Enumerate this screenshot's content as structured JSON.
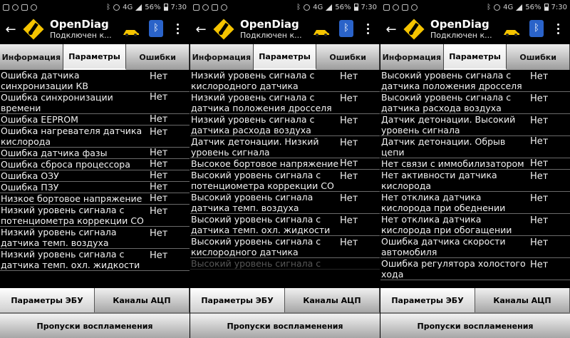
{
  "status_bar": {
    "time": "7:30",
    "battery": "56%",
    "network": "4G"
  },
  "app": {
    "title": "OpenDiag",
    "subtitle": "Подключен к..."
  },
  "tabs": [
    "Информация",
    "Параметры",
    "Ошибки"
  ],
  "active_tab": "Параметры",
  "bottom": {
    "ecu_params": "Параметры ЭБУ",
    "adc_channels": "Каналы АЦП",
    "misfires": "Пропуски воспламенения"
  },
  "screens": [
    {
      "rows": [
        {
          "name": "Ошибка датчика синхронизации КВ",
          "value": "Нет"
        },
        {
          "name": "Ошибка синхронизации времени",
          "value": "Нет"
        },
        {
          "name": "Ошибка EEPROM",
          "value": "Нет"
        },
        {
          "name": "Ошибка нагревателя датчика кислорода",
          "value": "Нет"
        },
        {
          "name": "Ошибка датчика фазы",
          "value": "Нет"
        },
        {
          "name": "Ошибка сброса процессора",
          "value": "Нет"
        },
        {
          "name": "Ошибка ОЗУ",
          "value": "Нет"
        },
        {
          "name": "Ошибка ПЗУ",
          "value": "Нет"
        },
        {
          "name": "Низкое бортовое напряжение",
          "value": "Нет"
        },
        {
          "name": "Низкий уровень сигнала с потенциометра коррекции CO",
          "value": "Нет"
        },
        {
          "name": "Низкий уровень сигнала датчика темп. воздуха",
          "value": "Нет"
        },
        {
          "name": "Низкий уровень сигнала с датчика темп. охл. жидкости",
          "value": "Нет"
        }
      ]
    },
    {
      "rows": [
        {
          "name": "Низкий уровень сигнала с кислородного датчика",
          "value": "Нет"
        },
        {
          "name": "Низкий уровень сигнала с датчика положения дросселя",
          "value": "Нет"
        },
        {
          "name": "Низкий уровень сигнала с датчика расхода воздуха",
          "value": "Нет"
        },
        {
          "name": "Датчик детонации. Низкий уровень сигнала",
          "value": "Нет"
        },
        {
          "name": "Высокое бортовое напряжение",
          "value": "Нет"
        },
        {
          "name": "Высокий уровень сигнала с потенциометра коррекции CO",
          "value": "Нет"
        },
        {
          "name": "Высокий уровень сигнала датчика темп. воздуха",
          "value": "Нет"
        },
        {
          "name": "Высокий уровень сигнала с датчика темп. охл. жидкости",
          "value": "Нет"
        },
        {
          "name": "Высокий уровень сигнала с кислородного датчика",
          "value": "Нет"
        },
        {
          "name": "Высокий уровень сигнала с",
          "value": ""
        }
      ]
    },
    {
      "rows": [
        {
          "name": "Высокий уровень сигнала с датчика положения дросселя",
          "value": "Нет"
        },
        {
          "name": "Высокий уровень сигнала с датчика расхода воздуха",
          "value": "Нет"
        },
        {
          "name": "Датчик детонации. Высокий уровень сигнала",
          "value": "Нет"
        },
        {
          "name": "Датчик детонации. Обрыв цепи",
          "value": "Нет"
        },
        {
          "name": "Нет связи с иммобилизатором",
          "value": "Нет"
        },
        {
          "name": "Нет активности датчика кислорода",
          "value": "Нет"
        },
        {
          "name": "Нет отклика датчика кислорода при обеднении",
          "value": "Нет"
        },
        {
          "name": "Нет отклика датчика кислорода при обогащении",
          "value": "Нет"
        },
        {
          "name": "Ошибка датчика скорости автомобиля",
          "value": "Нет"
        },
        {
          "name": "Ошибка регулятора холостого хода",
          "value": "Нет"
        }
      ]
    }
  ]
}
